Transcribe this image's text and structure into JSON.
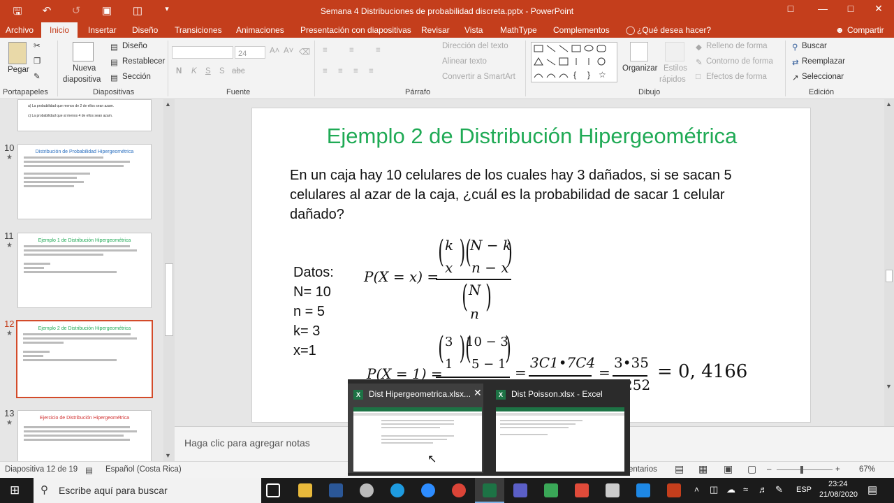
{
  "app": {
    "title": "Semana 4 Distribuciones de probabilidad discreta.pptx  -  PowerPoint",
    "brand_color": "#c43e1c"
  },
  "tabs": [
    "Archivo",
    "Inicio",
    "Insertar",
    "Diseño",
    "Transiciones",
    "Animaciones",
    "Presentación con diapositivas",
    "Revisar",
    "Vista",
    "MathType",
    "Complementos"
  ],
  "tellme": "¿Qué desea hacer?",
  "share": "Compartir",
  "ribbon": {
    "portapapeles": {
      "pegar": "Pegar",
      "label": "Portapapeles"
    },
    "diapositivas": {
      "nueva": "Nueva",
      "nueva2": "diapositiva",
      "diseno": "Diseño",
      "restablecer": "Restablecer",
      "seccion": "Sección",
      "label": "Diapositivas"
    },
    "fuente": {
      "size": "24",
      "label": "Fuente",
      "bold": "N",
      "italic": "K",
      "underline": "S",
      "strike": "S",
      "shadow": "abc"
    },
    "parrafo": {
      "direccion": "Dirección del texto",
      "alinear": "Alinear texto",
      "smartart": "Convertir a SmartArt",
      "label": "Párrafo"
    },
    "dibujo": {
      "organizar": "Organizar",
      "estilos": "Estilos",
      "estilos2": "rápidos",
      "relleno": "Relleno de forma",
      "contorno": "Contorno de forma",
      "efectos": "Efectos de forma",
      "label": "Dibujo"
    },
    "edicion": {
      "buscar": "Buscar",
      "reemplazar": "Reemplazar",
      "seleccionar": "Seleccionar",
      "label": "Edición"
    }
  },
  "thumbnails": [
    {
      "num": "",
      "title": "",
      "lines": [
        "a)  La probabilidad que menos de 2 de ellos sean azam.",
        "c)  La probabilidad que al menos 4 de ellos sean azam."
      ]
    },
    {
      "num": "10",
      "title": "Distribución de Probabilidad Hipergeométrica",
      "title_color": "#2a6fbf"
    },
    {
      "num": "11",
      "title": "Ejemplo 1 de Distribución Hipergeométrica",
      "title_color": "#1faa55"
    },
    {
      "num": "12",
      "title": "Ejemplo 2 de Distribución Hipergeométrica",
      "title_color": "#1faa55"
    },
    {
      "num": "13",
      "title": "Ejercicio de Distribución Hipergeométrica",
      "title_color": "#d03030"
    }
  ],
  "slide": {
    "title": "Ejemplo 2 de Distribución Hipergeométrica",
    "title_color": "#1faa55",
    "body": "En un caja hay 10 celulares de los cuales hay 3 dañados, si se sacan 5 celulares al azar de la caja, ¿cuál es la probabilidad de sacar 1 celular dañado?",
    "datos": [
      "Datos:",
      "N= 10",
      "n = 5",
      "k= 3",
      "x=1"
    ],
    "formula": {
      "lhs": "P(X = x) =",
      "k": "k",
      "x": "x",
      "Nk": "N − k",
      "nx": "n − x",
      "N": "N",
      "n": "n"
    },
    "calc": {
      "lhs": "P(X = 1) =",
      "a": "3",
      "b": "1",
      "c": "10 − 3",
      "d": "5 − 1",
      "eq1": "3C1•7C4",
      "eq2": "3•35",
      "den2": "252",
      "result": "= 0, 4166"
    }
  },
  "notes": "Haga clic para agregar notas",
  "status": {
    "slide": "Diapositiva 12 de 19",
    "lang": "Español (Costa Rica)",
    "comments": "entarios",
    "zoom": "67%"
  },
  "popup": {
    "items": [
      "Dist Hipergeometrica.xlsx...",
      "Dist Poisson.xlsx - Excel"
    ]
  },
  "taskbar": {
    "search": "Escribe aquí para buscar",
    "lang": "ESP",
    "time": "23:24",
    "date": "21/08/2020"
  }
}
